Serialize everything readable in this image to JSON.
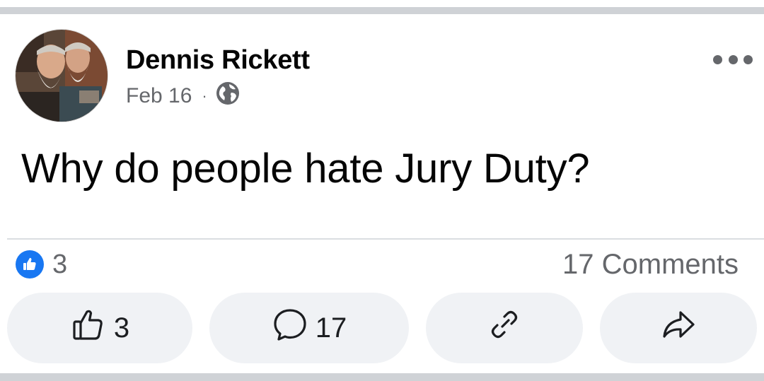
{
  "post": {
    "author": "Dennis Rickett",
    "date": "Feb 16",
    "separator": "·",
    "privacy_icon": "globe-icon",
    "message": "Why do people hate Jury Duty?"
  },
  "stats": {
    "reaction_icon": "like-reaction-icon",
    "reaction_count": "3",
    "comments_label": "17 Comments"
  },
  "actions": {
    "like_count": "3",
    "comment_count": "17",
    "link_icon": "link-icon",
    "share_icon": "share-icon"
  },
  "colors": {
    "accent": "#1877f2",
    "secondary_text": "#65676b",
    "button_bg": "#f0f2f5"
  }
}
